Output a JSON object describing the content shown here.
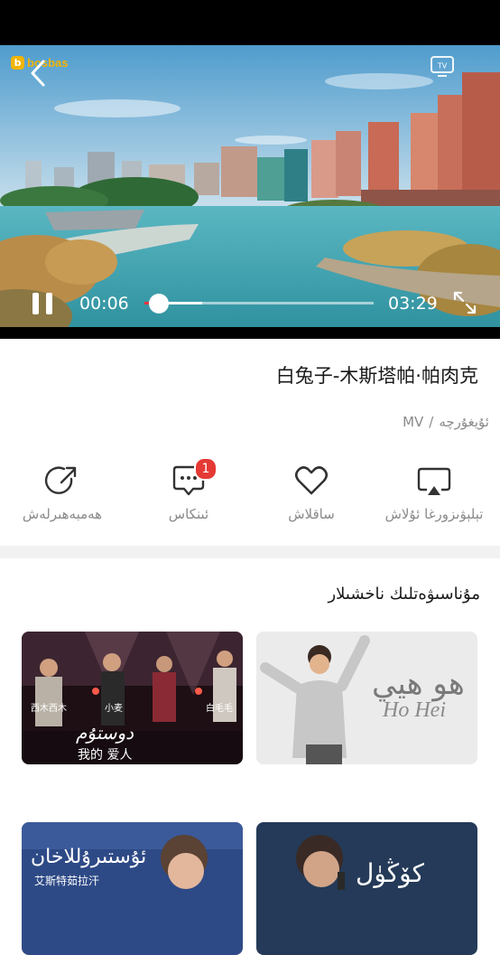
{
  "player": {
    "logo_text": "bosbas",
    "current_time": "00:06",
    "duration": "03:29",
    "played_fraction": 0.03,
    "buffered_fraction": 0.25,
    "tv_label": "TV"
  },
  "song": {
    "title": "白兔子-木斯塔帕·帕肉克",
    "type": "MV",
    "separator": "/",
    "language": "ئۇيغۇرچە"
  },
  "actions": [
    {
      "label": "تېلېۋىزورغا ئۇلاش",
      "icon": "cast-to-tv-icon"
    },
    {
      "label": "ساقلاش",
      "icon": "heart-icon"
    },
    {
      "label": "ئىنكاس",
      "icon": "comment-icon",
      "badge": "1"
    },
    {
      "label": "ھەمبەھىرلەش",
      "icon": "share-icon"
    }
  ],
  "related": {
    "title": "مۇناسىۋەتلىك ناخشىلار",
    "cards": [
      {
        "thumb_text": [
          "هو هيي",
          "Ho Hei"
        ]
      },
      {
        "thumb_text": [
          "西木西木",
          "小麦",
          "白毛毛",
          "دوستۇم",
          "我的 爱人"
        ]
      },
      {
        "thumb_text": [
          "كۆڭۈل",
          ""
        ]
      },
      {
        "thumb_text": [
          "ئۇستىرۇللاخان",
          "艾斯特茹拉汗"
        ]
      }
    ]
  },
  "colors": {
    "accent": "#e53935",
    "logo": "#f2b400",
    "muted_text": "#8a8a8a"
  }
}
